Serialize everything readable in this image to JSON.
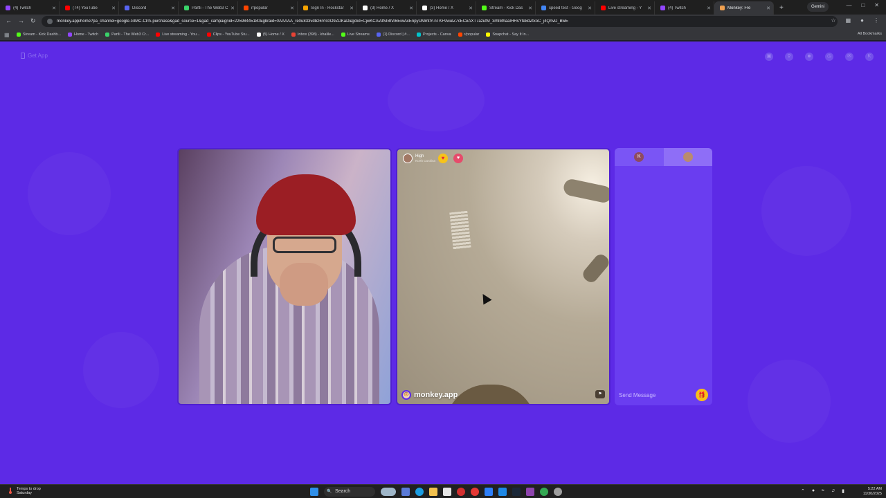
{
  "browser": {
    "tabs": [
      {
        "label": "(4) Twitch",
        "color": "#9146ff"
      },
      {
        "label": "(74) YouTube",
        "color": "#ff0000"
      },
      {
        "label": "Discord",
        "color": "#5865f2"
      },
      {
        "label": "Partli - The Web3 C",
        "color": "#3ad36a"
      },
      {
        "label": "r/popular",
        "color": "#ff4500"
      },
      {
        "label": "Sign In - Rockstar",
        "color": "#f7a400"
      },
      {
        "label": "(3) Home / X",
        "color": "#ffffff"
      },
      {
        "label": "(3) Home / X",
        "color": "#ffffff"
      },
      {
        "label": "Stream - Kick Das",
        "color": "#53fc18"
      },
      {
        "label": "speed test - Goog",
        "color": "#4285f4"
      },
      {
        "label": "Live streaming - Y",
        "color": "#ff0000"
      },
      {
        "label": "(4) Twitch",
        "color": "#9146ff"
      },
      {
        "label": "Monkey: Fre",
        "color": "#f0a050",
        "active": true
      }
    ],
    "gemini_label": "Gemini",
    "url": "monkey.app/home?pa_channel=google-GIMC-CPA-purchase&gad_source=1&gad_campaignid=22598445180&gbraid=0AAAAA_re0u833vdb26VIs0O9ZDKaD&gclid=CjwKCAiAlfvIBhA6EiwAcEnpyUMmtlY-nTKF9viuIZ7cECeAXT7azufM_3rhIMhaaIHHsYfe8dZtxoC_j4QAvD_BwE",
    "bookmarks": [
      {
        "label": "Stream - Kick Dashb...",
        "color": "#53fc18"
      },
      {
        "label": "Home - Twitch",
        "color": "#9146ff"
      },
      {
        "label": "Partli - The Web3 Cr...",
        "color": "#3ad36a"
      },
      {
        "label": "Live streaming - You...",
        "color": "#ff0000"
      },
      {
        "label": "Clips - YouTube Stu...",
        "color": "#ff0000"
      },
      {
        "label": "(5) Home / X",
        "color": "#ffffff"
      },
      {
        "label": "Inbox (398) - khalile...",
        "color": "#ea4335"
      },
      {
        "label": "Live Streams",
        "color": "#53fc18"
      },
      {
        "label": "(1) Discord | #...",
        "color": "#5865f2"
      },
      {
        "label": "Projects - Canva",
        "color": "#00c4cc"
      },
      {
        "label": "r/popular",
        "color": "#ff4500"
      },
      {
        "label": "Snapchat - Say It In...",
        "color": "#fffc00"
      }
    ],
    "all_bookmarks_label": "All Bookmarks"
  },
  "page": {
    "get_app_label": "Get App",
    "remote_user": {
      "name": "High",
      "location": "North Carolina"
    },
    "brand_label": "monkey.app",
    "chat": {
      "avatar_k_letter": "K",
      "placeholder": "Send Message"
    },
    "colors": {
      "background": "#5d2ae6",
      "chat": "#6a3df0",
      "gift": "#f8bf18"
    }
  },
  "taskbar": {
    "weather_line1": "Temps to drop",
    "weather_line2": "Saturday",
    "search_label": "Search",
    "time": "5:22 AM",
    "date": "11/30/2025"
  }
}
